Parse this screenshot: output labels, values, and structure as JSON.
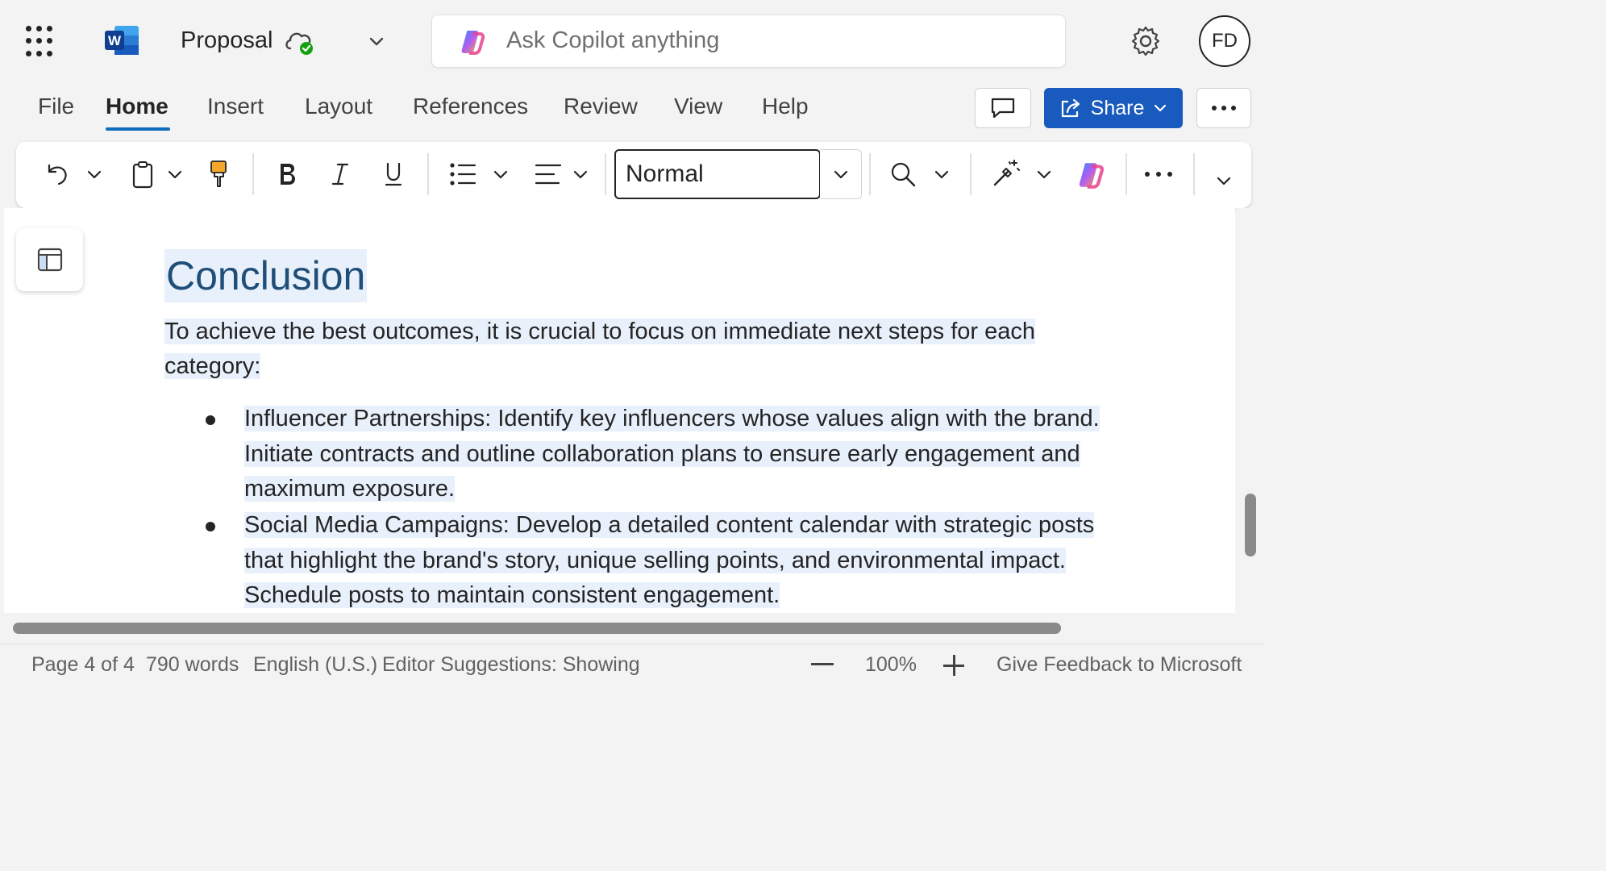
{
  "titlebar": {
    "doc_title": "Proposal",
    "copilot_placeholder": "Ask Copilot anything",
    "avatar_initials": "FD"
  },
  "ribbon": {
    "tabs": [
      {
        "label": "File"
      },
      {
        "label": "Home",
        "active": true
      },
      {
        "label": "Insert"
      },
      {
        "label": "Layout"
      },
      {
        "label": "References"
      },
      {
        "label": "Review"
      },
      {
        "label": "View"
      },
      {
        "label": "Help"
      }
    ],
    "share_label": "Share"
  },
  "toolbar": {
    "style_value": "Normal"
  },
  "document": {
    "heading": "Conclusion",
    "intro_line1": "To achieve the best outcomes, it is crucial to focus on immediate next steps for each",
    "intro_line2": "category:",
    "bullets": [
      {
        "lines": [
          "Influencer Partnerships: Identify key influencers whose values align with the brand. ",
          "Initiate contracts and outline collaboration plans to ensure early engagement and",
          "maximum exposure."
        ]
      },
      {
        "lines": [
          "Social Media Campaigns: Develop a detailed content calendar with strategic posts",
          "that highlight the brand's story, unique selling points, and environmental impact. ",
          "Schedule posts to maintain consistent engagement."
        ]
      }
    ]
  },
  "statusbar": {
    "page": "Page 4 of 4",
    "words": "790 words",
    "language": "English (U.S.)",
    "editor": "Editor Suggestions: Showing",
    "zoom": "100%",
    "feedback": "Give Feedback to Microsoft"
  },
  "colors": {
    "accent": "#185abd",
    "selection": "#e8f0fb",
    "heading": "#1f4e79"
  }
}
